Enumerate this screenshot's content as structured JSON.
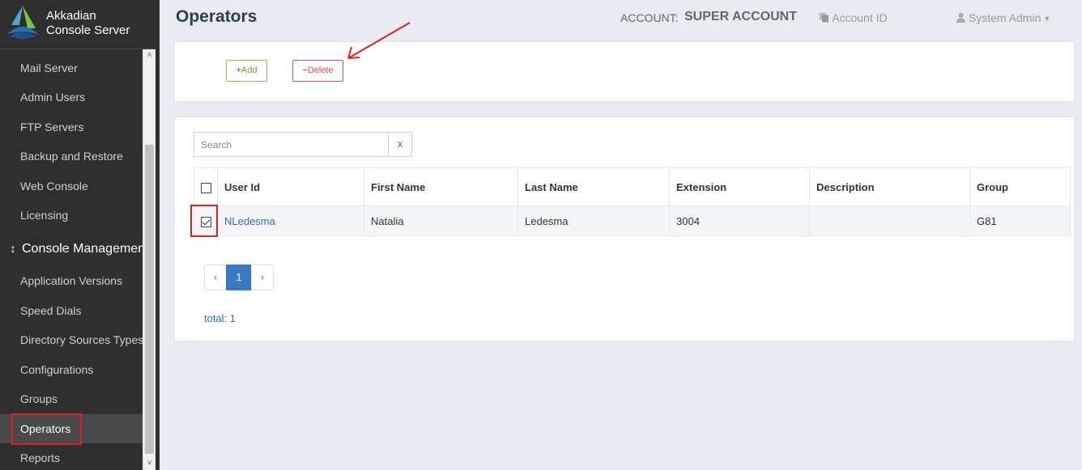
{
  "brand": {
    "line1": "Akkadian",
    "line2": "Console Server"
  },
  "sidebar": {
    "items": [
      {
        "label": "Mail Server"
      },
      {
        "label": "Admin Users"
      },
      {
        "label": "FTP Servers"
      },
      {
        "label": "Backup and Restore"
      },
      {
        "label": "Web Console"
      },
      {
        "label": "Licensing"
      }
    ],
    "section_header": "Console Management",
    "section_items": [
      {
        "label": "Application Versions"
      },
      {
        "label": "Speed Dials"
      },
      {
        "label": "Directory Sources Types"
      },
      {
        "label": "Configurations"
      },
      {
        "label": "Groups"
      },
      {
        "label": "Operators",
        "active": true
      },
      {
        "label": "Reports"
      }
    ]
  },
  "header": {
    "title": "Operators",
    "account_label": "ACCOUNT:",
    "account_value": "SUPER ACCOUNT",
    "account_id_label": "Account ID",
    "user_menu_label": "System Admin"
  },
  "toolbar": {
    "add_label": "Add",
    "delete_label": "Delete"
  },
  "search": {
    "placeholder": "Search",
    "clear_label": "x"
  },
  "table": {
    "columns": [
      "User Id",
      "First Name",
      "Last Name",
      "Extension",
      "Description",
      "Group"
    ],
    "rows": [
      {
        "user_id": "NLedesma",
        "first_name": "Natalia",
        "last_name": "Ledesma",
        "extension": "3004",
        "description": "",
        "group": "G81",
        "selected": true
      }
    ]
  },
  "pagination": {
    "prev": "‹",
    "current_page": "1",
    "next": "›"
  },
  "total_text": "total: 1",
  "colors": {
    "sidebar_bg": "#2f2f2f",
    "primary": "#3b78c2",
    "add_green": "#6aa336",
    "delete_red": "#d9534f",
    "highlight_red": "#e02020"
  }
}
